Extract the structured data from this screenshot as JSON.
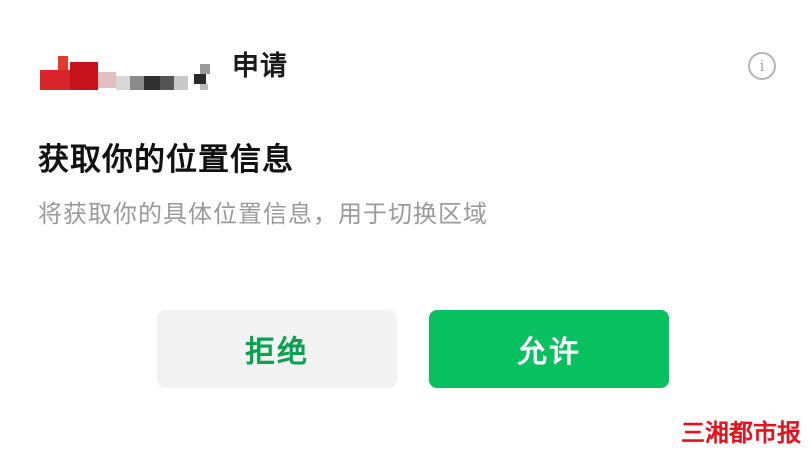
{
  "dialog": {
    "header_title": "申请",
    "info_icon": "info-circle-icon",
    "title": "获取你的位置信息",
    "subtitle": "将获取你的具体位置信息，用于切换区域"
  },
  "buttons": {
    "deny_label": "拒绝",
    "allow_label": "允许"
  },
  "watermark": {
    "text": "三湘都市报"
  },
  "colors": {
    "allow_bg": "#07c160",
    "deny_bg": "#f2f2f2",
    "deny_text": "#07a352",
    "subtitle_text": "#9a9a9a",
    "watermark": "#e8101d"
  }
}
